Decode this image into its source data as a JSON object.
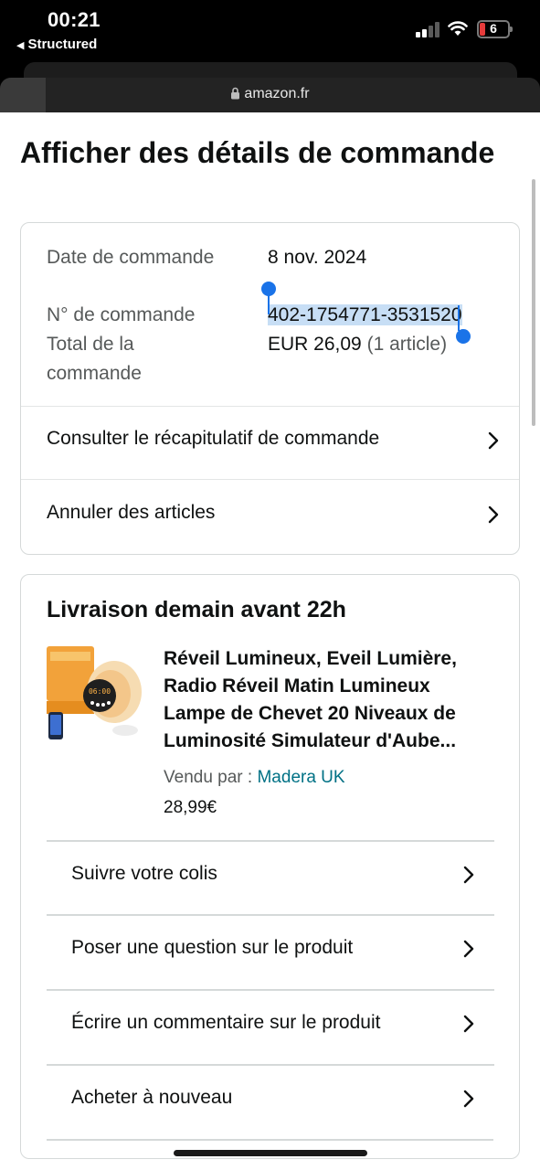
{
  "status_bar": {
    "time": "00:21",
    "back_app": "Structured",
    "battery": "6",
    "battery_color": "#e63b3b"
  },
  "browser": {
    "url": "amazon.fr"
  },
  "page": {
    "title": "Afficher des détails de commande"
  },
  "order_summary": {
    "date_label": "Date de commande",
    "date_value": "8 nov. 2024",
    "number_label": "N° de commande",
    "number_value": "402-1754771-3531520",
    "total_label": "Total de la commande",
    "total_value": "EUR 26,09",
    "total_count": "(1 article)",
    "links": [
      {
        "label": "Consulter le récapitulatif de commande"
      },
      {
        "label": "Annuler des articles"
      }
    ]
  },
  "delivery": {
    "title": "Livraison demain avant 22h",
    "product": {
      "title": "Réveil Lumineux, Eveil Lumière, Radio Réveil Matin Lumineux Lampe de Chevet 20 Niveaux de Luminosité Simulateur d'Aube...",
      "sold_by_label": "Vendu par",
      "sold_by_sep": " : ",
      "seller": "Madera UK",
      "price": "28,99€",
      "image_clock_text": "06:00"
    },
    "actions": [
      {
        "label": "Suivre votre colis"
      },
      {
        "label": "Poser une question sur le produit"
      },
      {
        "label": "Écrire un commentaire sur le produit"
      },
      {
        "label": "Acheter à nouveau"
      }
    ]
  },
  "colors": {
    "link": "#007185",
    "selection": "#c7def5",
    "handle": "#1a73e8"
  }
}
